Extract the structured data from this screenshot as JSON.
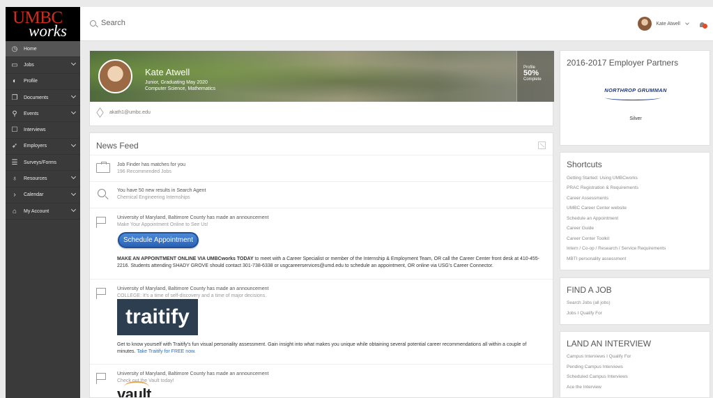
{
  "sidebar": {
    "logo": {
      "line1": "UMBC",
      "line2": "works"
    },
    "items": [
      {
        "label": "Home",
        "icon": "dashboard-icon",
        "active": true,
        "expandable": false
      },
      {
        "label": "Jobs",
        "icon": "briefcase-icon",
        "active": false,
        "expandable": true
      },
      {
        "label": "Profile",
        "icon": "profile-icon",
        "active": false,
        "expandable": false
      },
      {
        "label": "Documents",
        "icon": "documents-icon",
        "active": false,
        "expandable": true
      },
      {
        "label": "Events",
        "icon": "events-icon",
        "active": false,
        "expandable": true
      },
      {
        "label": "Interviews",
        "icon": "chat-icon",
        "active": false,
        "expandable": false
      },
      {
        "label": "Employers",
        "icon": "rocket-icon",
        "active": false,
        "expandable": true
      },
      {
        "label": "Surveys/Forms",
        "icon": "list-icon",
        "active": false,
        "expandable": false
      },
      {
        "label": "Resources",
        "icon": "lightbulb-icon",
        "active": false,
        "expandable": true
      },
      {
        "label": "Calendar",
        "icon": "chevron-right-icon",
        "active": false,
        "expandable": true
      },
      {
        "label": "My Account",
        "icon": "graduation-cap-icon",
        "active": false,
        "expandable": true
      }
    ]
  },
  "topbar": {
    "search_placeholder": "Search",
    "user_name": "Kate Atwell",
    "notification_count": "1"
  },
  "profile": {
    "name": "Kate Atwell",
    "line1": "Junior, Graduating May 2020",
    "line2": "Computer Science, Mathematics",
    "stat_label": "Profile",
    "stat_value": "50%",
    "stat_sub": "Complete",
    "email": "akath1@umbc.edu"
  },
  "feed": {
    "title": "News Feed",
    "items": [
      {
        "title": "Job Finder has matches for you",
        "sub": "196 Recommended Jobs"
      },
      {
        "title": "You have 50 new results in Search Agent",
        "sub": "Chemical Engineering Internships"
      },
      {
        "title": "University of Maryland, Baltimore County has made an announcement",
        "sub": "Make Your Appointment Online to See Us!",
        "button": "Schedule Appointment",
        "body_bold": "MAKE AN APPOINTMENT ONLINE VIA UMBCworks TODAY",
        "body": " to meet with a Career Specialist or member of the Internship & Employment Team, OR call the Career Center front desk at 410-455-2216. Students attending SHADY GROVE should contact 301-738-6338 or usgcareerservices@umd.edu to schedule an appointment, OR online via USG's Career Connector."
      },
      {
        "title": "University of Maryland, Baltimore County has made an announcement",
        "sub": "COLLEGE: It's a time of self-discovery and a time of major decisions.",
        "image_text": "traitify",
        "body": "Get to know yourself with Traitify's fun visual personality assessment. Gain insight into what makes you unique while obtaining several potential career recommendations all within a couple of minutes. ",
        "link": "Take Traitify for FREE now."
      },
      {
        "title": "University of Maryland, Baltimore County has made an announcement",
        "sub": "Check out the Vault today!",
        "image_text": "vault"
      }
    ]
  },
  "partners": {
    "title": "2016-2017 Employer Partners",
    "logo_text": "NORTHROP GRUMMAN",
    "tier": "Silver"
  },
  "shortcuts": {
    "title": "Shortcuts",
    "links": [
      "Getting Started: Using UMBCworks",
      "PRAC Registration & Requirements",
      "Career Assessments",
      "UMBC Career Center website",
      "Schedule an Appointment",
      "Career Guide",
      "Career Center Toolkit",
      "Intern / Co-op / Research / Service Requirements",
      "MBTI personality assessment"
    ]
  },
  "find_job": {
    "title": "FIND A JOB",
    "links": [
      "Search Jobs (all jobs)",
      "Jobs I Qualify For"
    ]
  },
  "land_interview": {
    "title": "LAND AN INTERVIEW",
    "links": [
      "Campus Interviews I Qualify For",
      "Pending Campus Interviews",
      "Scheduled Campus Interviews",
      "Ace the Interview"
    ]
  }
}
